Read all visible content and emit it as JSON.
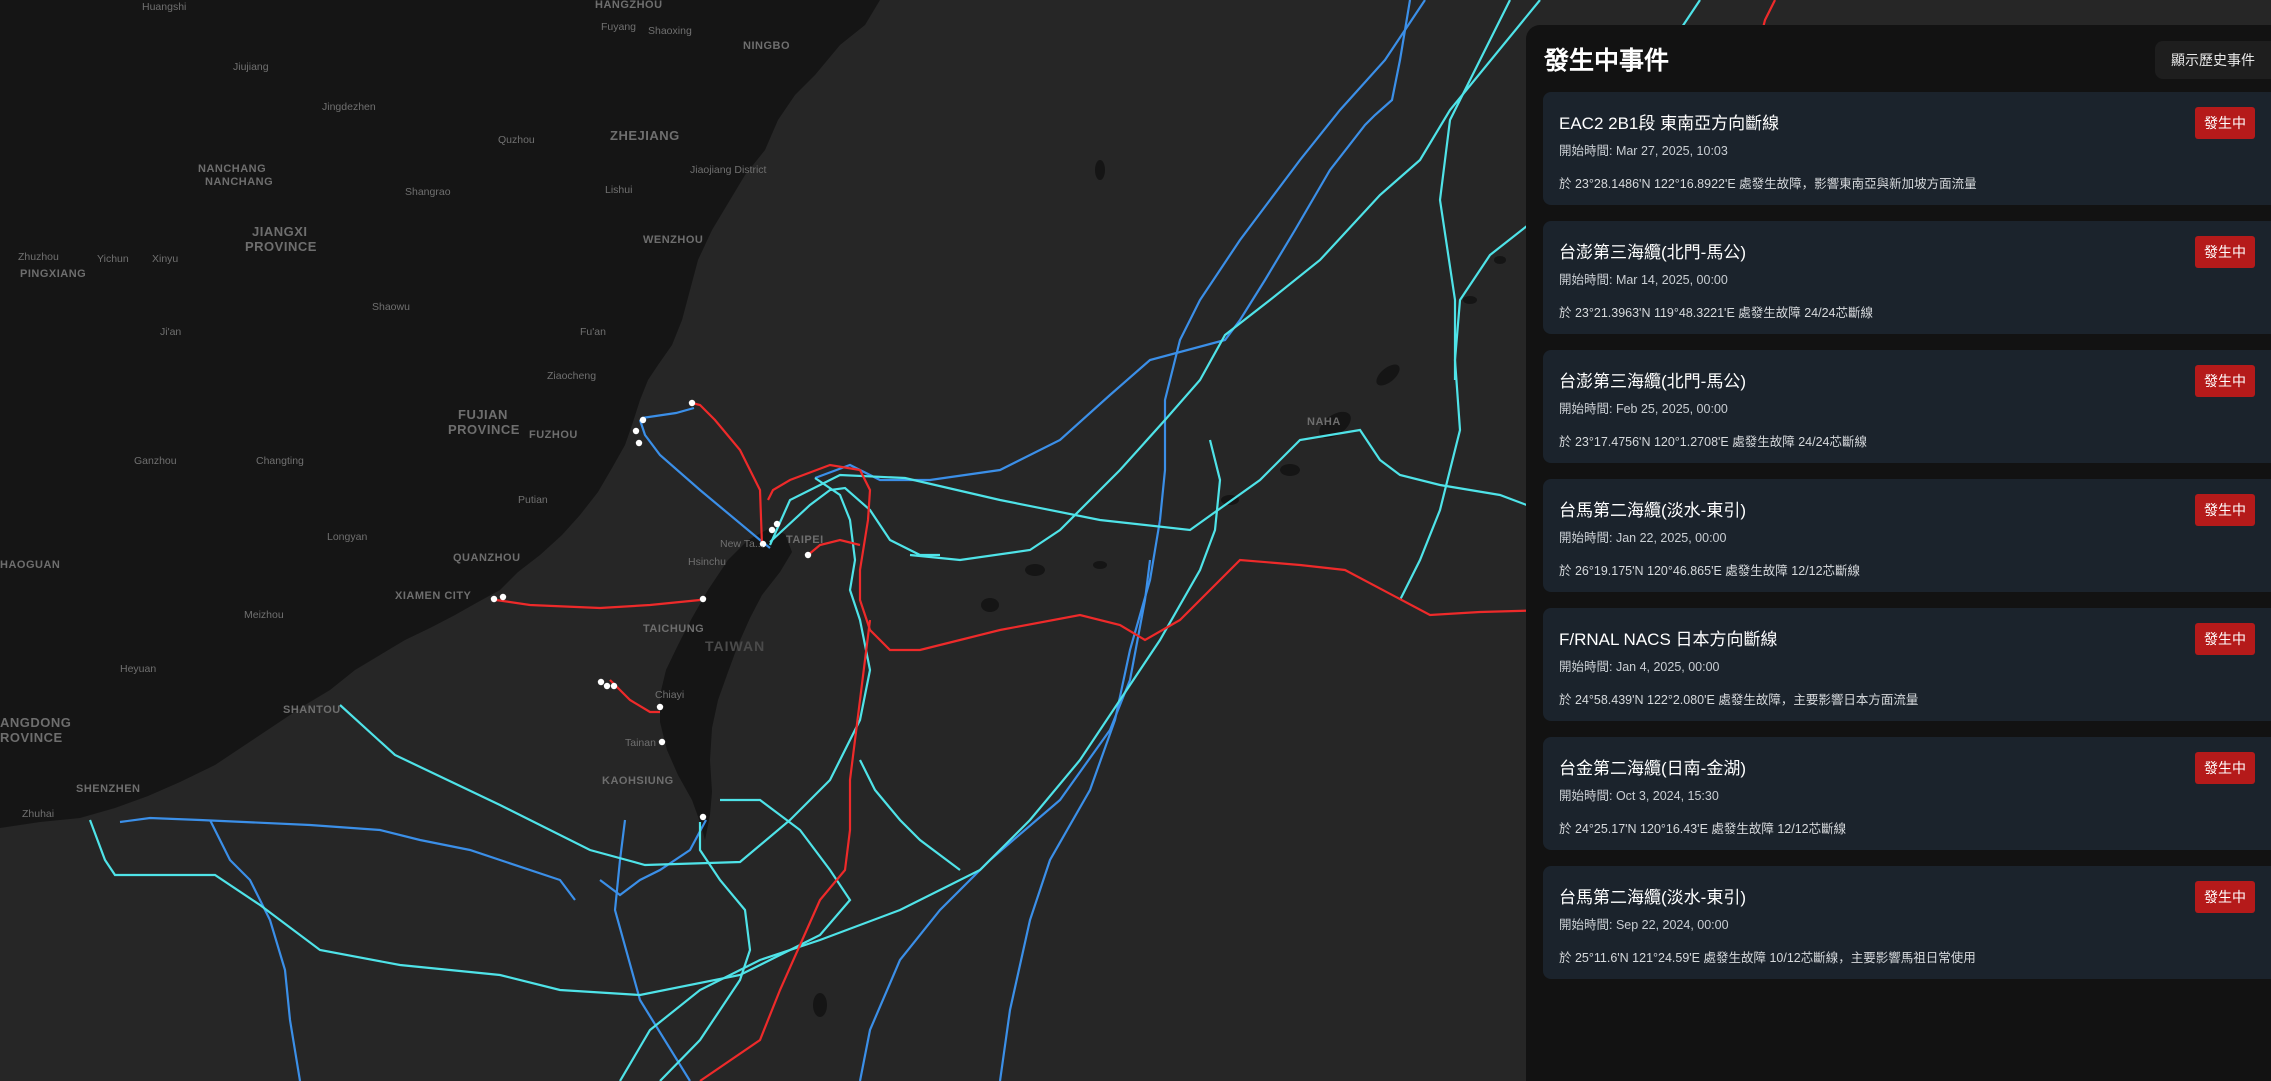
{
  "panel": {
    "title": "發生中事件",
    "history_button": "顯示歷史事件",
    "events": [
      {
        "title": "EAC2 2B1段 東南亞方向斷線",
        "start": "開始時間: Mar 27, 2025, 10:03",
        "desc": "於 23°28.1486'N 122°16.8922'E 處發生故障，影響東南亞與新加坡方面流量",
        "status": "發生中"
      },
      {
        "title": "台澎第三海纜(北門-馬公)",
        "start": "開始時間: Mar 14, 2025, 00:00",
        "desc": "於 23°21.3963'N 119°48.3221'E 處發生故障 24/24芯斷線",
        "status": "發生中"
      },
      {
        "title": "台澎第三海纜(北門-馬公)",
        "start": "開始時間: Feb 25, 2025, 00:00",
        "desc": "於 23°17.4756'N 120°1.2708'E 處發生故障 24/24芯斷線",
        "status": "發生中"
      },
      {
        "title": "台馬第二海纜(淡水-東引)",
        "start": "開始時間: Jan 22, 2025, 00:00",
        "desc": "於 26°19.175'N 120°46.865'E 處發生故障 12/12芯斷線",
        "status": "發生中"
      },
      {
        "title": "F/RNAL NACS 日本方向斷線",
        "start": "開始時間: Jan 4, 2025, 00:00",
        "desc": "於 24°58.439'N 122°2.080'E 處發生故障，主要影響日本方面流量",
        "status": "發生中"
      },
      {
        "title": "台金第二海纜(日南-金湖)",
        "start": "開始時間: Oct 3, 2024, 15:30",
        "desc": "於 24°25.17'N 120°16.43'E 處發生故障 12/12芯斷線",
        "status": "發生中"
      },
      {
        "title": "台馬第二海纜(淡水-東引)",
        "start": "開始時間: Sep 22, 2024, 00:00",
        "desc": "於 25°11.6'N 121°24.59'E 處發生故障 10/12芯斷線，主要影響馬祖日常使用",
        "status": "發生中"
      }
    ]
  },
  "map": {
    "labels": {
      "huangshi": "Huangshi",
      "hangzhou": "HANGZHOU",
      "fuyang": "Fuyang",
      "shaoxing": "Shaoxing",
      "ningbo": "NINGBO",
      "jiujiang": "Jiujiang",
      "jingdezhen": "Jingdezhen",
      "quzhou": "Quzhou",
      "zhejiang": "ZHEJIANG",
      "nanchang1": "NANCHANG",
      "nanchang2": "NANCHANG",
      "lishui": "Lishui",
      "jiaojiang": "Jiaojiang District",
      "shangrao": "Shangrao",
      "jiangxi1": "JIANGXI",
      "jiangxi2": "PROVINCE",
      "wenzhou": "WENZHOU",
      "zhuzhou": "Zhuzhou",
      "pingxiang": "PINGXIANG",
      "yichun": "Yichun",
      "xinyu": "Xinyu",
      "shaowu": "Shaowu",
      "jian": "Ji'an",
      "fuan": "Fu'an",
      "ziaocheng": "Ziaocheng",
      "fujian1": "FUJIAN",
      "fujian2": "PROVINCE",
      "fuzhou": "FUZHOU",
      "ganzhou": "Ganzhou",
      "changting": "Changting",
      "putian": "Putian",
      "longyan": "Longyan",
      "quanzhou": "QUANZHOU",
      "haoguan": "HAOGUAN",
      "xiamen": "XIAMEN CITY",
      "meizhou": "Meizhou",
      "heyuan": "Heyuan",
      "shantou": "SHANTOU",
      "angdong1": "ANGDONG",
      "angdong2": "ROVINCE",
      "shenzhen": "SHENZHEN",
      "zhuhai": "Zhuhai",
      "naha": "NAHA",
      "newtaipei": "New Ta...",
      "taipei": "TAIPEI",
      "hsinchu": "Hsinchu",
      "taichung": "TAICHUNG",
      "taiwan": "TAIWAN",
      "chiayi": "Chiayi",
      "tainan": "Tainan",
      "kaohsiung": "KAOHSIUNG"
    },
    "cable_colors": {
      "active": "#ee2a2a",
      "cyan": "#4fe3e8",
      "blue": "#3b8fe8"
    }
  }
}
